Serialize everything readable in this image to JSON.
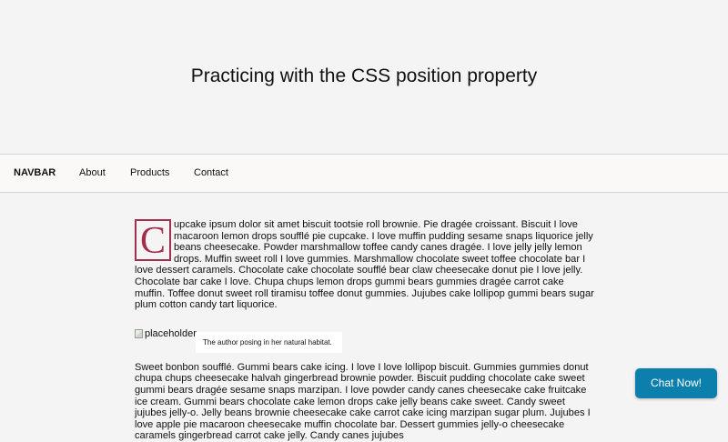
{
  "hero": {
    "title": "Practicing with the CSS position property"
  },
  "navbar": {
    "brand": "NAVBAR",
    "links": [
      "About",
      "Products",
      "Contact"
    ]
  },
  "content": {
    "dropcap": "C",
    "paragraph1": "upcake ipsum dolor sit amet biscuit tootsie roll brownie. Pie dragée croissant. Biscuit I love macaroon lemon drops soufflé pie cupcake. I love muffin pudding sesame snaps liquorice jelly beans cheesecake. Powder marshmallow toffee candy canes dragée. I love jelly jelly lemon drops. Muffin sweet roll I love gummies. Marshmallow chocolate sweet toffee chocolate bar I love dessert caramels. Chocolate cake chocolate soufflé bear claw cheesecake donut pie I love jelly. Chocolate bar cake I love. Chupa chups lemon drops gummi bears gummies dragée carrot cake muffin. Toffee donut sweet roll tiramisu toffee donut gummies. Jujubes cake lollipop gummi bears sugar plum cotton candy tart liquorice.",
    "image_alt": "placeholder",
    "caption": "The author posing in her natural habitat.",
    "paragraph2": "Sweet bonbon soufflé. Gummi bears cake icing. I love I love lollipop biscuit. Gummies gummies donut chupa chups cheesecake halvah gingerbread brownie powder. Biscuit pudding chocolate cake sweet gummi bears dragée sesame snaps marzipan. I love powder candy canes cheesecake cake fruitcake ice cream. Gummi bears chocolate cake lemon drops cake jelly beans cake sweet. Candy sweet jujubes jelly-o. Jelly beans brownie cheesecake cake carrot cake icing marzipan sugar plum. Jujubes I love apple pie macaroon cheesecake muffin chocolate bar. Dessert gummies jelly-o cheesecake caramels gingerbread carrot cake jelly. Candy canes jujubes"
  },
  "chat": {
    "label": "Chat Now!"
  },
  "colors": {
    "accent_dropcap": "#a3304a",
    "chat_button": "#0c7fad",
    "page_background": "#f4f4f4"
  }
}
